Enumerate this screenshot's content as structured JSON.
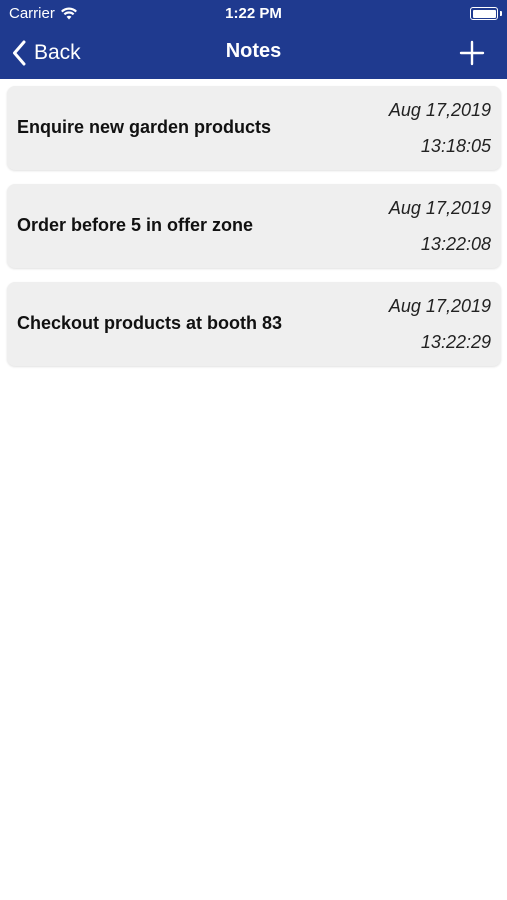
{
  "status_bar": {
    "carrier": "Carrier",
    "time": "1:22 PM"
  },
  "nav": {
    "back_label": "Back",
    "title": "Notes"
  },
  "notes": [
    {
      "title": "Enquire new garden products",
      "date": "Aug 17,2019",
      "time": "13:18:05"
    },
    {
      "title": "Order before 5 in offer zone",
      "date": "Aug 17,2019",
      "time": "13:22:08"
    },
    {
      "title": "Checkout products at booth 83",
      "date": "Aug 17,2019",
      "time": "13:22:29"
    }
  ],
  "colors": {
    "nav_background": "#1f3a8f",
    "card_background": "#efefef"
  },
  "icons": {
    "back": "chevron-left-icon",
    "add": "plus-icon",
    "wifi": "wifi-icon",
    "battery": "battery-icon"
  }
}
